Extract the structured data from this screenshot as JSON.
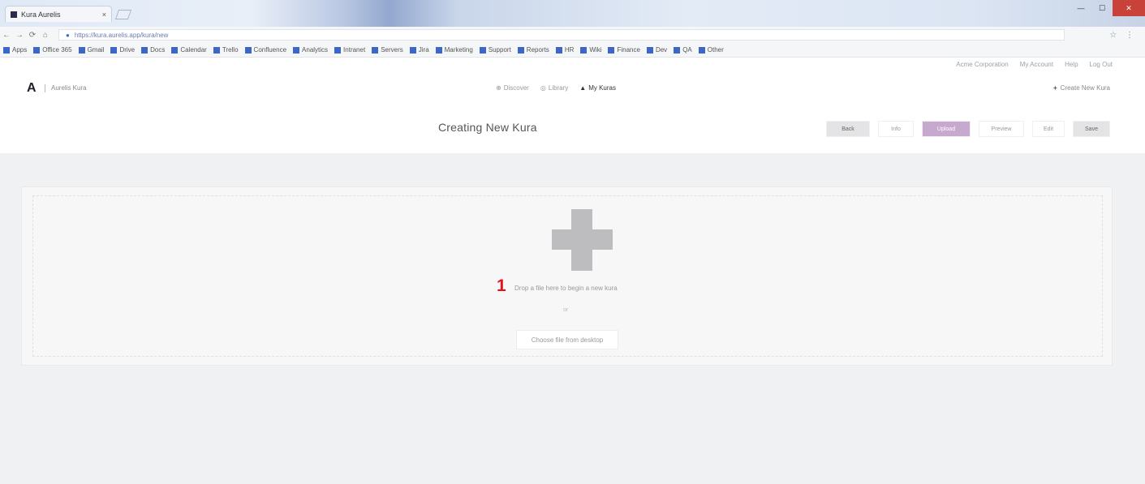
{
  "browser": {
    "tab_title": "Kura Aurelis",
    "tab_close": "×",
    "url": "https://kura.aurelis.app/kura/new",
    "nav_icons": [
      "←",
      "→",
      "⟳",
      "⌂"
    ],
    "extras": "☆ ⋮",
    "window_controls": [
      "—",
      "☐",
      "✕"
    ],
    "bookmarks": [
      "Apps",
      "Office 365",
      "Gmail",
      "Drive",
      "Docs",
      "Calendar",
      "Trello",
      "Confluence",
      "Analytics",
      "Intranet",
      "Servers",
      "Jira",
      "Marketing",
      "Support",
      "Reports",
      "HR",
      "Wiki",
      "Finance",
      "Dev",
      "QA",
      "Other"
    ]
  },
  "header": {
    "top_links": [
      "Acme Corporation",
      "My Account",
      "Help",
      "Log Out"
    ],
    "logo": "A",
    "brand": "Aurelis Kura",
    "nav": [
      {
        "icon": "⊕",
        "label": "Discover",
        "active": false
      },
      {
        "icon": "◎",
        "label": "Library",
        "active": false
      },
      {
        "icon": "▲",
        "label": "My Kuras",
        "active": true
      }
    ],
    "create_icon": "+",
    "create_label": "Create New Kura"
  },
  "page": {
    "title": "Creating New Kura",
    "steps": [
      {
        "label": "Back",
        "style": "gray"
      },
      {
        "label": "Info",
        "style": "white"
      },
      {
        "label": "Upload",
        "style": "purple"
      },
      {
        "label": "Preview",
        "style": "white"
      },
      {
        "label": "Edit",
        "style": "white"
      },
      {
        "label": "Save",
        "style": "gray"
      }
    ]
  },
  "upload": {
    "step_number": "1",
    "hint": "Drop a file here to begin a new kura",
    "or": "or",
    "browse_label": "Choose file from desktop"
  }
}
